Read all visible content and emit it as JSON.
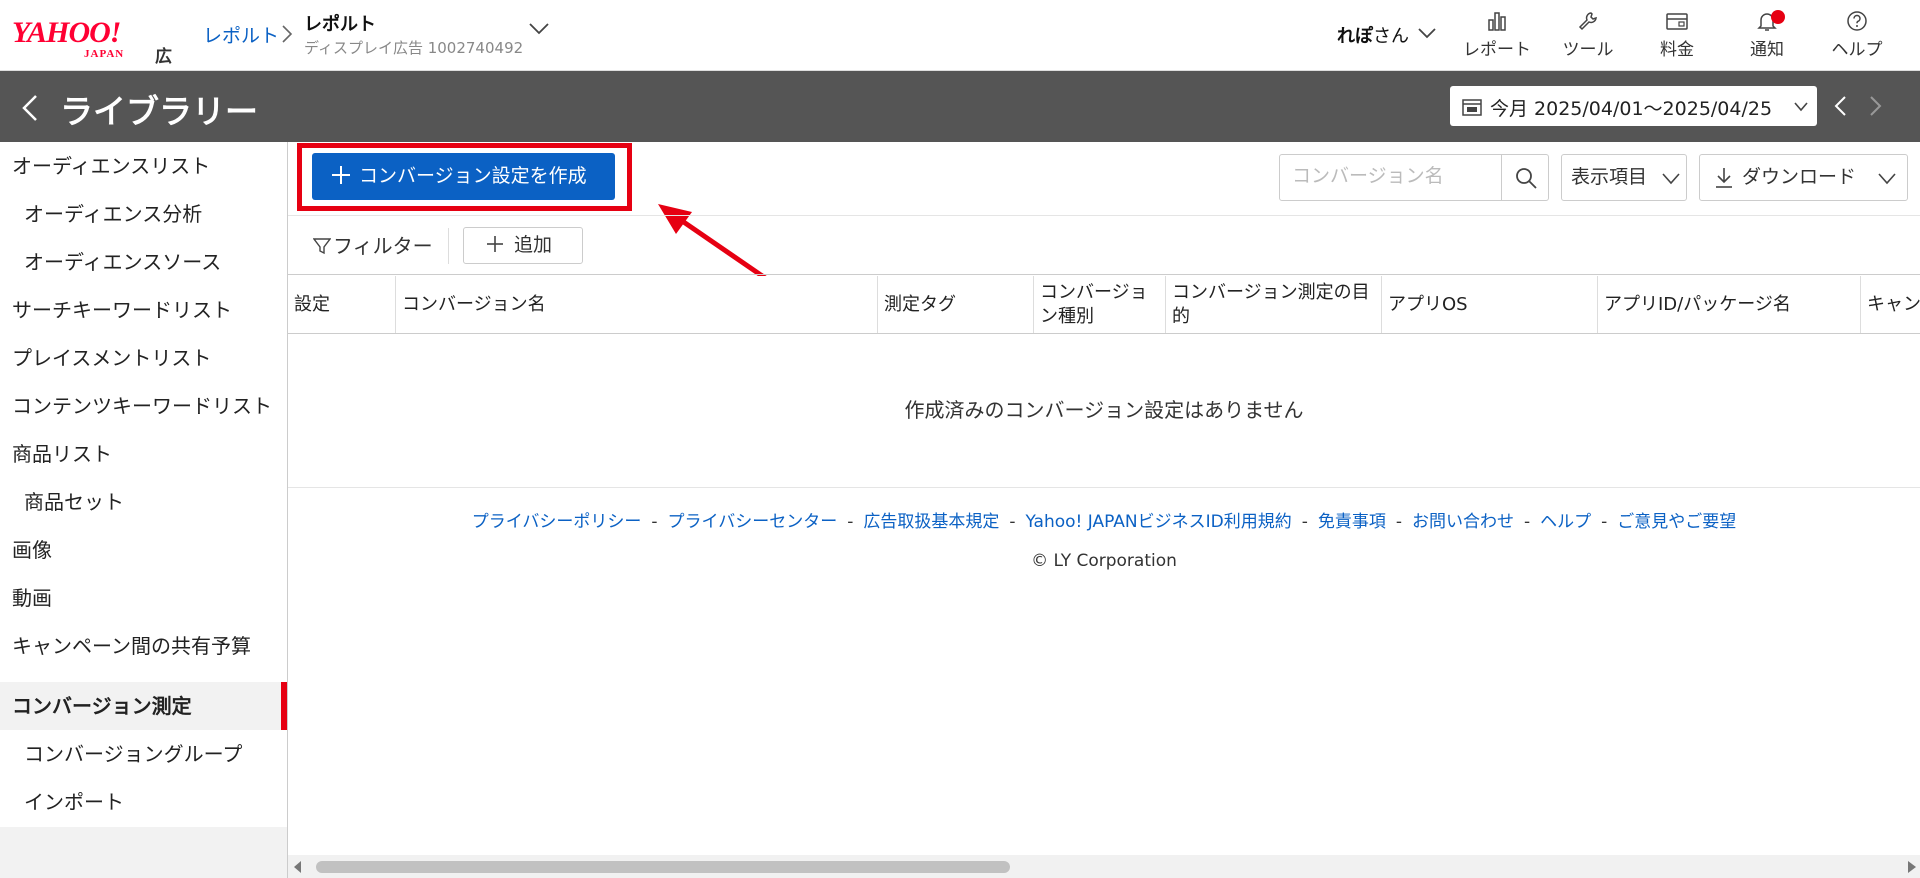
{
  "header": {
    "logo": "YAHOO!",
    "logo_sub": "JAPAN",
    "logo_ad": "広告",
    "breadcrumb_link": "レポルト",
    "account_name": "レポルト",
    "account_sub": "ディスプレイ広告 1002740492",
    "user_name": "れぽ",
    "user_suffix": "さん",
    "nav": [
      {
        "label": "レポート",
        "icon": "bar-chart-icon"
      },
      {
        "label": "ツール",
        "icon": "wrench-icon"
      },
      {
        "label": "料金",
        "icon": "billing-icon"
      },
      {
        "label": "通知",
        "icon": "bell-icon"
      },
      {
        "label": "ヘルプ",
        "icon": "help-circle-icon"
      }
    ]
  },
  "titlebar": {
    "title": "ライブラリー",
    "date_range": "今月 2025/04/01～2025/04/25"
  },
  "sidebar": {
    "items": [
      {
        "label": "オーディエンスリスト",
        "level": 1
      },
      {
        "label": "オーディエンス分析",
        "level": 2
      },
      {
        "label": "オーディエンスソース",
        "level": 2
      },
      {
        "label": "サーチキーワードリスト",
        "level": 1
      },
      {
        "label": "プレイスメントリスト",
        "level": 1
      },
      {
        "label": "コンテンツキーワードリスト",
        "level": 1
      },
      {
        "label": "商品リスト",
        "level": 1
      },
      {
        "label": "商品セット",
        "level": 2
      },
      {
        "label": "画像",
        "level": 1
      },
      {
        "label": "動画",
        "level": 1
      },
      {
        "label": "キャンペーン間の共有予算",
        "level": 1
      },
      {
        "label": "コンバージョン測定",
        "level": 1,
        "active": true
      },
      {
        "label": "コンバージョングループ",
        "level": 2
      },
      {
        "label": "インポート",
        "level": 2
      }
    ]
  },
  "toolbar": {
    "create_label": "コンバージョン設定を作成",
    "search_placeholder": "コンバージョン名",
    "columns_label": "表示項目",
    "download_label": "ダウンロード",
    "filter_label": "フィルター",
    "add_label": "追加"
  },
  "table": {
    "columns": [
      "設定",
      "コンバージョン名",
      "測定タグ",
      "コンバージョン種別",
      "コンバージョン測定の目的",
      "アプリOS",
      "アプリID/パッケージ名",
      "キャン"
    ],
    "empty_message": "作成済みのコンバージョン設定はありません"
  },
  "footer": {
    "links": [
      "プライバシーポリシー",
      "プライバシーセンター",
      "広告取扱基本規定",
      "Yahoo! JAPANビジネスID利用規約",
      "免責事項",
      "お問い合わせ",
      "ヘルプ",
      "ご意見やご要望"
    ],
    "copyright": "© LY Corporation"
  },
  "colors": {
    "accent": "#0b61c4",
    "brand_red": "#ff0033",
    "highlight_red": "#e60012",
    "titlebar_bg": "#555555"
  }
}
